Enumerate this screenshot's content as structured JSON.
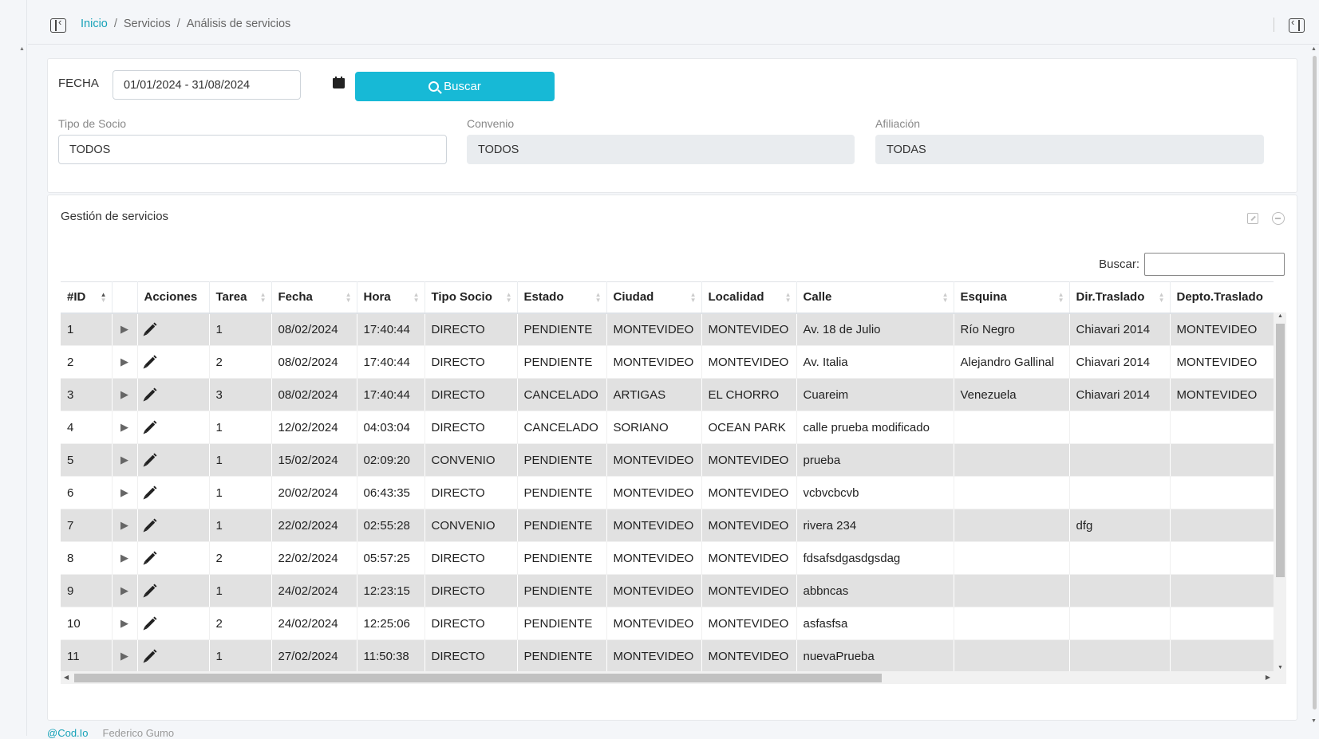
{
  "breadcrumb": {
    "home": "Inicio",
    "section": "Servicios",
    "current": "Análisis de servicios",
    "separator": "/"
  },
  "filters": {
    "fecha_label": "FECHA",
    "fecha_value": "01/01/2024 - 31/08/2024",
    "buscar_label": "Buscar",
    "tipo_socio_label": "Tipo de Socio",
    "tipo_socio_value": "TODOS",
    "convenio_label": "Convenio",
    "convenio_value": "TODOS",
    "afiliacion_label": "Afiliación",
    "afiliacion_value": "TODAS"
  },
  "table_card": {
    "title": "Gestión de servicios",
    "search_label": "Buscar:"
  },
  "columns": [
    "#ID",
    "",
    "Acciones",
    "Tarea",
    "Fecha",
    "Hora",
    "Tipo Socio",
    "Estado",
    "Ciudad",
    "Localidad",
    "Calle",
    "Esquina",
    "Dir.Traslado",
    "Depto.Traslado"
  ],
  "rows": [
    [
      "1",
      "▶",
      "",
      "1",
      "08/02/2024",
      "17:40:44",
      "DIRECTO",
      "PENDIENTE",
      "MONTEVIDEO",
      "MONTEVIDEO",
      "Av. 18 de Julio",
      "Río Negro",
      "Chiavari 2014",
      "MONTEVIDEO"
    ],
    [
      "2",
      "▶",
      "",
      "2",
      "08/02/2024",
      "17:40:44",
      "DIRECTO",
      "PENDIENTE",
      "MONTEVIDEO",
      "MONTEVIDEO",
      "Av. Italia",
      "Alejandro Gallinal",
      "Chiavari 2014",
      "MONTEVIDEO"
    ],
    [
      "3",
      "▶",
      "",
      "3",
      "08/02/2024",
      "17:40:44",
      "DIRECTO",
      "CANCELADO",
      "ARTIGAS",
      "EL CHORRO",
      "Cuareim",
      "Venezuela",
      "Chiavari 2014",
      "MONTEVIDEO"
    ],
    [
      "4",
      "▶",
      "",
      "1",
      "12/02/2024",
      "04:03:04",
      "DIRECTO",
      "CANCELADO",
      "SORIANO",
      "OCEAN PARK",
      "calle prueba modificado",
      "",
      "",
      ""
    ],
    [
      "5",
      "▶",
      "",
      "1",
      "15/02/2024",
      "02:09:20",
      "CONVENIO",
      "PENDIENTE",
      "MONTEVIDEO",
      "MONTEVIDEO",
      "prueba",
      "",
      "",
      ""
    ],
    [
      "6",
      "▶",
      "",
      "1",
      "20/02/2024",
      "06:43:35",
      "DIRECTO",
      "PENDIENTE",
      "MONTEVIDEO",
      "MONTEVIDEO",
      "vcbvcbcvb",
      "",
      "",
      ""
    ],
    [
      "7",
      "▶",
      "",
      "1",
      "22/02/2024",
      "02:55:28",
      "CONVENIO",
      "PENDIENTE",
      "MONTEVIDEO",
      "MONTEVIDEO",
      "rivera 234",
      "",
      "dfg",
      ""
    ],
    [
      "8",
      "▶",
      "",
      "2",
      "22/02/2024",
      "05:57:25",
      "DIRECTO",
      "PENDIENTE",
      "MONTEVIDEO",
      "MONTEVIDEO",
      "fdsafsdgasdgsdag",
      "",
      "",
      ""
    ],
    [
      "9",
      "▶",
      "",
      "1",
      "24/02/2024",
      "12:23:15",
      "DIRECTO",
      "PENDIENTE",
      "MONTEVIDEO",
      "MONTEVIDEO",
      "abbncas",
      "",
      "",
      ""
    ],
    [
      "10",
      "▶",
      "",
      "2",
      "24/02/2024",
      "12:25:06",
      "DIRECTO",
      "PENDIENTE",
      "MONTEVIDEO",
      "MONTEVIDEO",
      "asfasfsa",
      "",
      "",
      ""
    ],
    [
      "11",
      "▶",
      "",
      "1",
      "27/02/2024",
      "11:50:38",
      "DIRECTO",
      "PENDIENTE",
      "MONTEVIDEO",
      "MONTEVIDEO",
      "nuevaPrueba",
      "",
      "",
      ""
    ]
  ],
  "footer": {
    "brand": "@Cod.Io",
    "author": "Federico Gumo"
  },
  "colors": {
    "accent": "#17b9d6",
    "link": "#17a2b8",
    "odd_row": "#e1e1e1"
  },
  "icons": {
    "sidebar_toggle": "sidebar-toggle-icon",
    "calendar": "calendar-icon",
    "search": "search-icon",
    "edit": "pencil-icon",
    "expand_row": "play-icon",
    "maximize": "expand-icon",
    "collapse": "minus-circle-icon"
  }
}
